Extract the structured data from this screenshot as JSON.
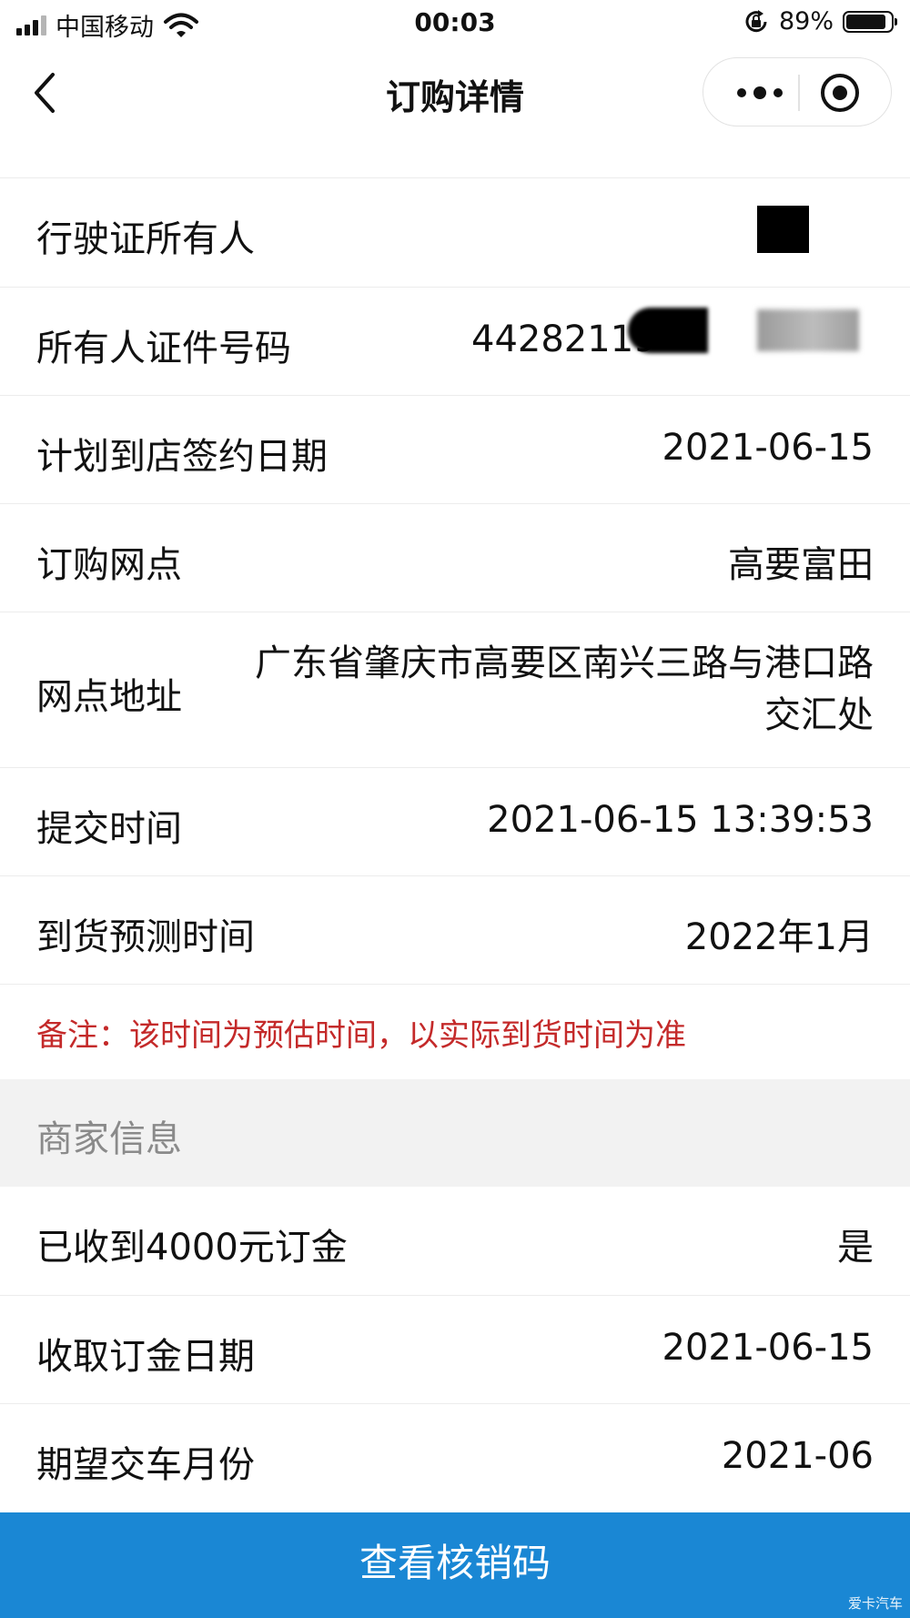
{
  "status_bar": {
    "carrier": "中国移动",
    "time": "00:03",
    "battery_percent": "89%",
    "battery_level": 0.89,
    "icons": [
      "signal-icon",
      "wifi-icon",
      "rotation-lock-icon",
      "battery-icon"
    ]
  },
  "nav": {
    "title": "订购详情",
    "icons": [
      "back-icon",
      "more-icon",
      "target-icon"
    ]
  },
  "rows": [
    {
      "label": "行驶证所有人",
      "value": ""
    },
    {
      "label": "所有人证件号码",
      "value": "44282119"
    },
    {
      "label": "计划到店签约日期",
      "value": "2021-06-15"
    },
    {
      "label": "订购网点",
      "value": "高要富田"
    },
    {
      "label": "网点地址",
      "value": "广东省肇庆市高要区南兴三路与港口路交汇处"
    },
    {
      "label": "提交时间",
      "value": "2021-06-15 13:39:53"
    },
    {
      "label": "到货预测时间",
      "value": "2022年1月"
    }
  ],
  "note": "备注：该时间为预估时间，以实际到货时间为准",
  "merchant_section": {
    "title": "商家信息",
    "rows": [
      {
        "label": "已收到4000元订金",
        "value": "是"
      },
      {
        "label": "收取订金日期",
        "value": "2021-06-15"
      },
      {
        "label": "期望交车月份",
        "value": "2021-06"
      }
    ]
  },
  "button": {
    "label": "查看核销码"
  },
  "watermark": "爱卡汽车",
  "colors": {
    "button_bg": "#1a87d4",
    "note_text": "#c42a2a",
    "section_bg": "#f2f2f2",
    "divider": "#ececec"
  }
}
